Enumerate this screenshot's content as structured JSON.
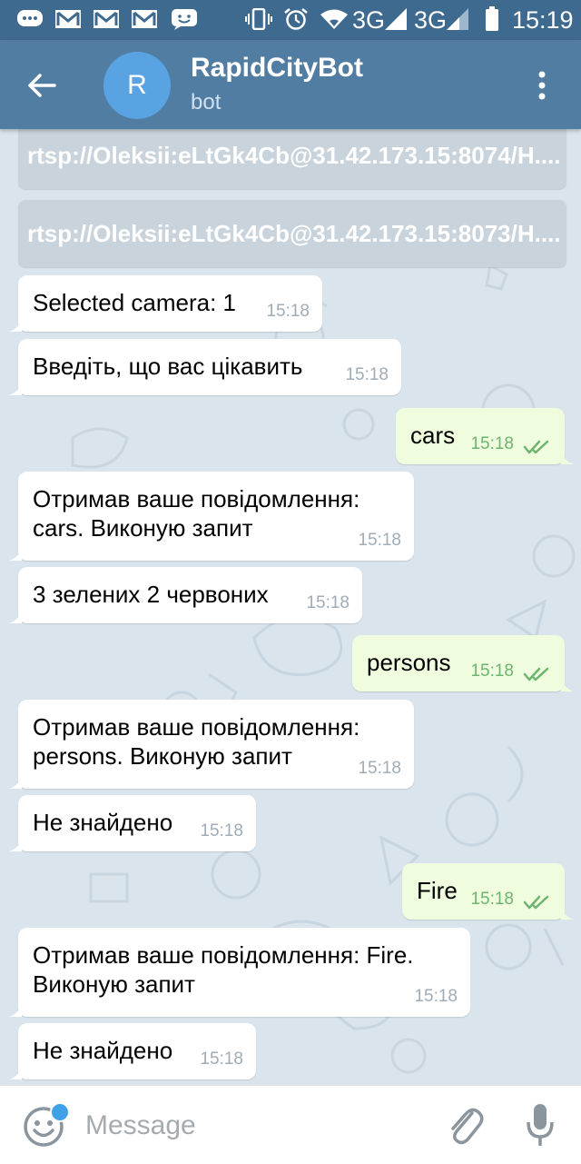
{
  "statusbar": {
    "left_icons": [
      "chat-bubble-icon",
      "gmail-icon",
      "gmail-icon",
      "gmail-icon",
      "message-icon"
    ],
    "right_icons": [
      "vibrate-icon",
      "alarm-icon",
      "wifi-icon",
      "signal-icon",
      "signal-icon",
      "battery-icon"
    ],
    "network1": "3G",
    "network2": "3G",
    "time": "15:19"
  },
  "header": {
    "avatar_letter": "R",
    "title": "RapidCityBot",
    "subtitle": "bot"
  },
  "messages": [
    {
      "type": "url",
      "text": "rtsp://Oleksii:eLtGk4Cb@31.42.173.15:8074/H...."
    },
    {
      "type": "url",
      "text": "rtsp://Oleksii:eLtGk4Cb@31.42.173.15:8073/H...."
    },
    {
      "type": "in",
      "text": "Selected camera: 1",
      "time": "15:18"
    },
    {
      "type": "in",
      "text": "Введіть, що вас цікавить",
      "time": "15:18"
    },
    {
      "type": "out",
      "text": "cars",
      "time": "15:18",
      "read": true
    },
    {
      "type": "in",
      "text": "Отримав ваше повідомлення:\ncars. Виконую запит",
      "time": "15:18"
    },
    {
      "type": "in",
      "text": "3 зелених 2 червоних",
      "time": "15:18"
    },
    {
      "type": "out",
      "text": "persons",
      "time": "15:18",
      "read": true
    },
    {
      "type": "in",
      "text": "Отримав ваше повідомлення:\npersons. Виконую запит",
      "time": "15:18"
    },
    {
      "type": "in",
      "text": "Не знайдено",
      "time": "15:18"
    },
    {
      "type": "out",
      "text": "Fire",
      "time": "15:18",
      "read": true
    },
    {
      "type": "in",
      "text": "Отримав ваше повідомлення: Fire.\nВиконую запит",
      "time": "15:18"
    },
    {
      "type": "in",
      "text": "Не знайдено",
      "time": "15:18"
    }
  ],
  "input": {
    "placeholder": "Message",
    "value": ""
  },
  "colors": {
    "header": "#517da2",
    "statusbar": "#3e6a90",
    "chat_bg": "#d9e4ec",
    "bubble_in": "#ffffff",
    "bubble_out": "#effdde",
    "check": "#6db56f",
    "accent": "#3fa1e8"
  }
}
